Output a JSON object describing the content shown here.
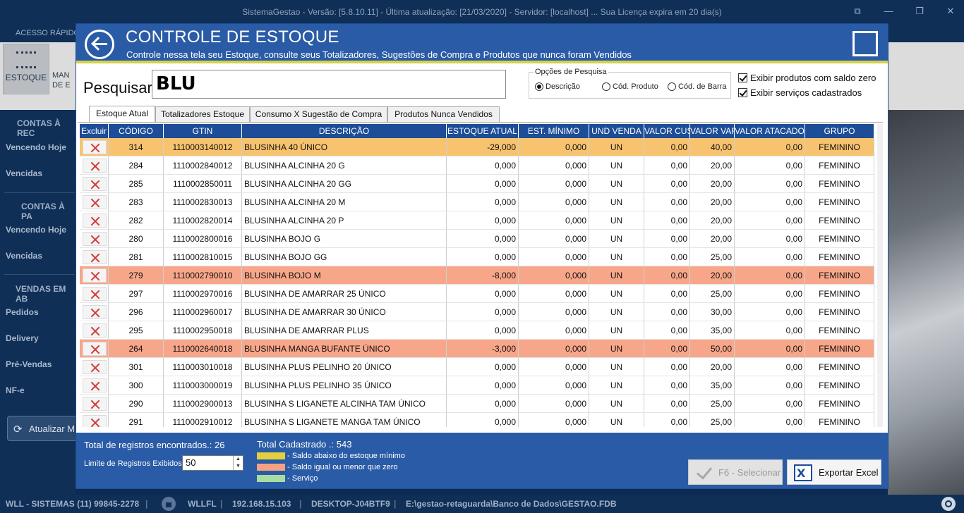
{
  "window": {
    "title": "SistemaGestao - Versão: [5.8.10.11] - Última atualização: [21/03/2020] - Servidor: [localhost] ... Sua Licença expira em 20 dia(s)"
  },
  "quick_access": "ACESSO RÁPIDO",
  "ribbon": {
    "estoque": "ESTOQUE",
    "mand_1": "MAN",
    "mand_2": "DE E"
  },
  "leftnav": {
    "sec1": "CONTAS À REC",
    "sec1_items": [
      "Vencendo Hoje",
      "Vencidas"
    ],
    "sec2": "CONTAS À PA",
    "sec2_items": [
      "Vencendo Hoje",
      "Vencidas"
    ],
    "sec3": "VENDAS EM AB",
    "sec3_items": [
      "Pedidos",
      "Delivery",
      "Pré-Vendas",
      "NF-e"
    ],
    "refresh": "Atualizar M"
  },
  "status": {
    "company": "WLL - SISTEMAS (11) 99845-2278",
    "user": "WLLFL",
    "ip": "192.168.15.103",
    "host": "DESKTOP-J04BTF9",
    "db": "E:\\gestao-retaguarda\\Banco de Dados\\GESTAO.FDB"
  },
  "modal": {
    "title": "CONTROLE DE ESTOQUE",
    "subtitle": "Controle nessa tela seu Estoque, consulte seus Totalizadores, Sugestões de Compra e Produtos que nunca foram Vendidos",
    "search_label": "Pesquisar:",
    "search_value": "BLU",
    "options_legend": "Opções de Pesquisa",
    "options": [
      "Descrição",
      "Cód. Produto",
      "Cód. de Barra"
    ],
    "selected_option": "Descrição",
    "check_zero": "Exibir produtos com saldo zero",
    "check_services": "Exibir serviços cadastrados",
    "tabs": [
      "Estoque Atual",
      "Totalizadores Estoque",
      "Consumo X Sugestão de Compra",
      "Produtos Nunca Vendidos"
    ],
    "columns": [
      "Excluir",
      "CÓDIGO",
      "GTIN",
      "DESCRIÇÃO",
      "ESTOQUE ATUAL",
      "EST. MÍNIMO",
      "UND VENDA",
      "VALOR CUSTO",
      "VALOR VAREJO",
      "VALOR ATACADO",
      "GRUPO"
    ],
    "rows": [
      {
        "cod": "314",
        "gtin": "1110003140012",
        "desc": "BLUSINHA 40 ÚNICO",
        "est": "-29,000",
        "min": "0,000",
        "und": "UN",
        "cus": "0,00",
        "var": "40,00",
        "ata": "0,00",
        "grp": "FEMININO",
        "hl": "#f8c36f"
      },
      {
        "cod": "284",
        "gtin": "1110002840012",
        "desc": "BLUSINHA ALCINHA 20 G",
        "est": "0,000",
        "min": "0,000",
        "und": "UN",
        "cus": "0,00",
        "var": "20,00",
        "ata": "0,00",
        "grp": "FEMININO",
        "hl": ""
      },
      {
        "cod": "285",
        "gtin": "1110002850011",
        "desc": "BLUSINHA ALCINHA 20 GG",
        "est": "0,000",
        "min": "0,000",
        "und": "UN",
        "cus": "0,00",
        "var": "20,00",
        "ata": "0,00",
        "grp": "FEMININO",
        "hl": ""
      },
      {
        "cod": "283",
        "gtin": "1110002830013",
        "desc": "BLUSINHA ALCINHA 20 M",
        "est": "0,000",
        "min": "0,000",
        "und": "UN",
        "cus": "0,00",
        "var": "20,00",
        "ata": "0,00",
        "grp": "FEMININO",
        "hl": ""
      },
      {
        "cod": "282",
        "gtin": "1110002820014",
        "desc": "BLUSINHA ALCINHA 20 P",
        "est": "0,000",
        "min": "0,000",
        "und": "UN",
        "cus": "0,00",
        "var": "20,00",
        "ata": "0,00",
        "grp": "FEMININO",
        "hl": ""
      },
      {
        "cod": "280",
        "gtin": "1110002800016",
        "desc": "BLUSINHA BOJO G",
        "est": "0,000",
        "min": "0,000",
        "und": "UN",
        "cus": "0,00",
        "var": "20,00",
        "ata": "0,00",
        "grp": "FEMININO",
        "hl": ""
      },
      {
        "cod": "281",
        "gtin": "1110002810015",
        "desc": "BLUSINHA BOJO GG",
        "est": "0,000",
        "min": "0,000",
        "und": "UN",
        "cus": "0,00",
        "var": "25,00",
        "ata": "0,00",
        "grp": "FEMININO",
        "hl": ""
      },
      {
        "cod": "279",
        "gtin": "1110002790010",
        "desc": "BLUSINHA BOJO M",
        "est": "-8,000",
        "min": "0,000",
        "und": "UN",
        "cus": "0,00",
        "var": "20,00",
        "ata": "0,00",
        "grp": "FEMININO",
        "hl": "#f8a68a"
      },
      {
        "cod": "297",
        "gtin": "1110002970016",
        "desc": "BLUSINHA DE AMARRAR 25 ÚNICO",
        "est": "0,000",
        "min": "0,000",
        "und": "UN",
        "cus": "0,00",
        "var": "25,00",
        "ata": "0,00",
        "grp": "FEMININO",
        "hl": ""
      },
      {
        "cod": "296",
        "gtin": "1110002960017",
        "desc": "BLUSINHA DE AMARRAR 30 ÚNICO",
        "est": "0,000",
        "min": "0,000",
        "und": "UN",
        "cus": "0,00",
        "var": "30,00",
        "ata": "0,00",
        "grp": "FEMININO",
        "hl": ""
      },
      {
        "cod": "295",
        "gtin": "1110002950018",
        "desc": "BLUSINHA DE AMARRAR PLUS",
        "est": "0,000",
        "min": "0,000",
        "und": "UN",
        "cus": "0,00",
        "var": "35,00",
        "ata": "0,00",
        "grp": "FEMININO",
        "hl": ""
      },
      {
        "cod": "264",
        "gtin": "1110002640018",
        "desc": "BLUSINHA MANGA BUFANTE ÚNICO",
        "est": "-3,000",
        "min": "0,000",
        "und": "UN",
        "cus": "0,00",
        "var": "50,00",
        "ata": "0,00",
        "grp": "FEMININO",
        "hl": "#f8a68a"
      },
      {
        "cod": "301",
        "gtin": "1110003010018",
        "desc": "BLUSINHA PLUS PELINHO 20 ÚNICO",
        "est": "0,000",
        "min": "0,000",
        "und": "UN",
        "cus": "0,00",
        "var": "20,00",
        "ata": "0,00",
        "grp": "FEMININO",
        "hl": ""
      },
      {
        "cod": "300",
        "gtin": "1110003000019",
        "desc": "BLUSINHA PLUS PELINHO 35 ÚNICO",
        "est": "0,000",
        "min": "0,000",
        "und": "UN",
        "cus": "0,00",
        "var": "35,00",
        "ata": "0,00",
        "grp": "FEMININO",
        "hl": ""
      },
      {
        "cod": "290",
        "gtin": "1110002900013",
        "desc": "BLUSINHA S LIGANETE ALCINHA TAM ÚNICO",
        "est": "0,000",
        "min": "0,000",
        "und": "UN",
        "cus": "0,00",
        "var": "25,00",
        "ata": "0,00",
        "grp": "FEMININO",
        "hl": ""
      },
      {
        "cod": "291",
        "gtin": "1110002910012",
        "desc": "BLUSINHA S LIGANETE MANGA TAM ÚNICO",
        "est": "0,000",
        "min": "0,000",
        "und": "UN",
        "cus": "0,00",
        "var": "25,00",
        "ata": "0,00",
        "grp": "FEMININO",
        "hl": ""
      }
    ],
    "footer": {
      "total_found": "Total de registros encontrados.: 26",
      "total_cadastrado": "Total Cadastrado .: 543",
      "limit_label": "Limite de Registros Exibidos:",
      "limit_value": "50",
      "legend": [
        {
          "label": "- Saldo abaixo do estoque mínimo",
          "color": "#e4cf3c"
        },
        {
          "label": "- Saldo igual ou menor que zero",
          "color": "#f7a183"
        },
        {
          "label": "- Serviço",
          "color": "#a8dca0"
        }
      ],
      "select_btn": "F6 - Selecionar",
      "export_btn": "Exportar Excel"
    }
  }
}
